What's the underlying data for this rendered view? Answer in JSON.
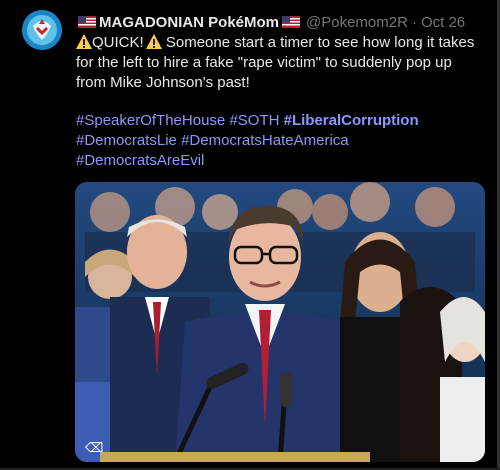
{
  "tweet": {
    "author": {
      "name": "MAGADONIAN PokéMom",
      "handle": "@Pokemom2R",
      "avatar_icon": "avatar-icon"
    },
    "date": "Oct 26",
    "text": "QUICK! Someone start a timer to see how long it takes for the left to hire a fake \"rape victim\" to suddenly pop up from Mike Johnson's past!",
    "text_start": "QUICK!",
    "text_rest": "Someone start a timer to see how long it takes for the left to hire a fake \"rape victim\" to suddenly pop up from Mike Johnson's past!",
    "hashtags": [
      "#SpeakerOfTheHouse",
      "#SOTH",
      "#LiberalCorruption",
      "#DemocratsLie",
      "#DemocratsHateAmerica",
      "#DemocratsAreEvil"
    ]
  },
  "colors": {
    "background": "#000000",
    "text": "#e7e9ea",
    "muted": "#71767b",
    "link": "#8b98f9"
  }
}
